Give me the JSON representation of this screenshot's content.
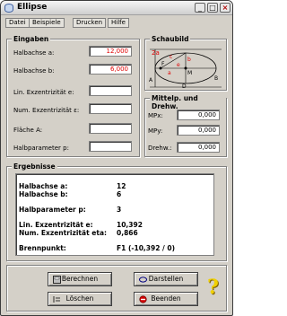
{
  "window": {
    "title": "Ellipse"
  },
  "menu": [
    "Datei",
    "Beispiele",
    "Drucken",
    "Hilfe"
  ],
  "eingaben": {
    "title": "Eingaben",
    "rows": [
      {
        "label": "Halbachse a:",
        "value": "12,000"
      },
      {
        "label": "Halbachse b:",
        "value": "6,000"
      },
      {
        "label": "Lin. Exzentrizität e:",
        "value": ""
      },
      {
        "label": "Num. Exzentrizität ε:",
        "value": ""
      },
      {
        "label": "Fläche A:",
        "value": ""
      },
      {
        "label": "Halbparameter p:",
        "value": ""
      }
    ]
  },
  "schaubild": {
    "title": "Schaubild",
    "labels": {
      "two_a": "2a",
      "a": "a",
      "b": "b",
      "c": "c",
      "e": "e",
      "f": "F",
      "m": "M",
      "a_pt": "A",
      "b_pt": "B",
      "d_pt": "D"
    }
  },
  "mittelpunkt": {
    "title": "Mittelp. und Drehw.",
    "rows": [
      {
        "label": "MPx:",
        "value": "0,000"
      },
      {
        "label": "MPy:",
        "value": "0,000"
      },
      {
        "label": "Drehw.:",
        "value": "0,000"
      }
    ]
  },
  "ergebnisse": {
    "title": "Ergebnisse",
    "rows": [
      {
        "label": "Halbachse a:",
        "value": "12"
      },
      {
        "label": "Halbachse b:",
        "value": "6"
      },
      {
        "label": "Halbparameter p:",
        "value": "3"
      },
      {
        "label": "Lin. Exzentrizität e:",
        "value": "10,392"
      },
      {
        "label": "Num. Exzentrizität eta:",
        "value": "0,866"
      },
      {
        "label": "Brennpunkt:",
        "value": "F1 (-10,392 / 0)"
      }
    ]
  },
  "buttons": {
    "berechnen": "Berechnen",
    "darstellen": "Darstellen",
    "loeschen": "Löschen",
    "beenden": "Beenden"
  },
  "colors": {
    "accent_red": "#e00000",
    "help_yellow": "#f0d000"
  }
}
